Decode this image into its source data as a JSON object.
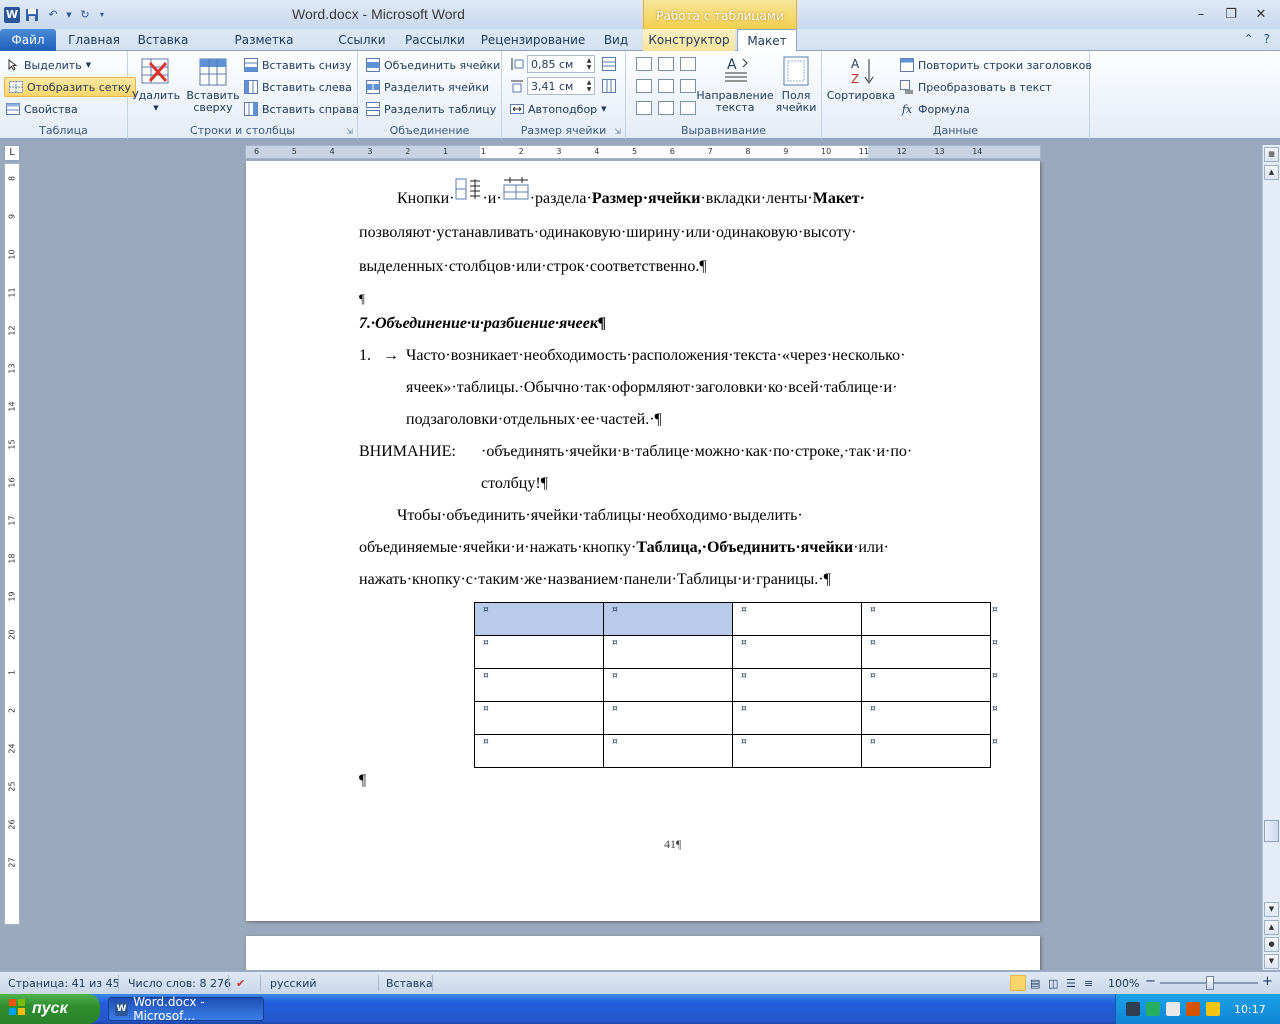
{
  "window": {
    "title": "Word.docx  -  Microsoft Word",
    "context_tab_group": "Работа с таблицами"
  },
  "tabs": {
    "file": "Файл",
    "home": "Главная",
    "insert": "Вставка",
    "page_layout": "Разметка страницы",
    "references": "Ссылки",
    "mailings": "Рассылки",
    "review": "Рецензирование",
    "view": "Вид",
    "design": "Конструктор",
    "layout": "Макет"
  },
  "ribbon": {
    "table_group": {
      "label": "Таблица",
      "select": "Выделить",
      "view_gridlines": "Отобразить сетку",
      "properties": "Свойства"
    },
    "rows_cols_group": {
      "label": "Строки и столбцы",
      "delete": "Удалить",
      "insert_above_1": "Вставить",
      "insert_above_2": "сверху",
      "insert_below": "Вставить снизу",
      "insert_left": "Вставить слева",
      "insert_right": "Вставить справа"
    },
    "merge_group": {
      "label": "Объединение",
      "merge_cells": "Объединить ячейки",
      "split_cells": "Разделить ячейки",
      "split_table": "Разделить таблицу"
    },
    "cell_size_group": {
      "label": "Размер ячейки",
      "height": "0,85 см",
      "width": "3,41 см",
      "autofit": "Автоподбор"
    },
    "alignment_group": {
      "label": "Выравнивание",
      "text_direction_1": "Направление",
      "text_direction_2": "текста",
      "cell_margins_1": "Поля",
      "cell_margins_2": "ячейки"
    },
    "sort": "Сортировка",
    "data_group": {
      "label": "Данные",
      "repeat_header": "Повторить строки заголовков",
      "convert_to_text": "Преобразовать в текст",
      "formula": "Формула"
    }
  },
  "document": {
    "p1_line1_a": "Кнопки·",
    "p1_line1_b": "·и·",
    "p1_line1_c": "·раздела·",
    "p1_line1_bold1": "Размер·ячейки",
    "p1_line1_d": "·вкладки·ленты·",
    "p1_line1_bold2": "Макет·",
    "p1_line2": "позволяют·устанавливать·одинаковую·ширину·или·одинаковую·высоту·",
    "p1_line3": "выделенных·столбцов·или·строк·соответственно.¶",
    "empty_para": "¶",
    "heading": "7.·Объединение·и·разбиение·ячеек¶",
    "list_num": "1.",
    "list_arrow": "→",
    "list_line1": "Часто·возникает·необходимость·расположения·текста·«через·несколько·",
    "list_line2": "ячеек»·таблицы.·Обычно·так·оформляют·заголовки·ко·всей·таблице·и·",
    "list_line3": "подзаголовки·отдельных·ее·частей.·¶",
    "warn_label": "ВНИМАНИЕ:",
    "warn_line1": "·объединять·ячейки·в·таблице·можно·как·по·строке,·так·и·по·",
    "warn_line2": "столбцу!¶",
    "p3_line1": "Чтобы·объединить·ячейки·таблицы·необходимо·выделить·",
    "p3_line2_a": "объединяемые·ячейки·и·нажать·кнопку·",
    "p3_line2_bold": "Таблица,·Объединить·ячейки",
    "p3_line2_b": "·или·",
    "p3_line3": "нажать·кнопку·с·таким·же·названием·панели·Таблицы·и·границы.·¶",
    "cell_mark": "¤",
    "row_end_mark": "¤",
    "after_table": "¶",
    "page_number": "41¶"
  },
  "ruler": {
    "h_labels": [
      "6",
      "5",
      "4",
      "3",
      "2",
      "1",
      "1",
      "2",
      "3",
      "4",
      "5",
      "6",
      "7",
      "8",
      "9",
      "10",
      "11",
      "12",
      "13",
      "14"
    ],
    "v_labels": [
      "8",
      "9",
      "10",
      "11",
      "12",
      "13",
      "14",
      "15",
      "16",
      "17",
      "18",
      "19",
      "20",
      "1",
      "2",
      "24",
      "25",
      "26",
      "27"
    ],
    "corner": "L"
  },
  "statusbar": {
    "page": "Страница: 41 из 45",
    "words": "Число слов: 8 276",
    "language": "русский",
    "mode": "Вставка",
    "zoom": "100%",
    "zoom_minus": "−",
    "zoom_plus": "+"
  },
  "taskbar": {
    "start": "пуск",
    "task": "Word.docx - Microsof…",
    "lang": "RL",
    "time": "10:17"
  }
}
